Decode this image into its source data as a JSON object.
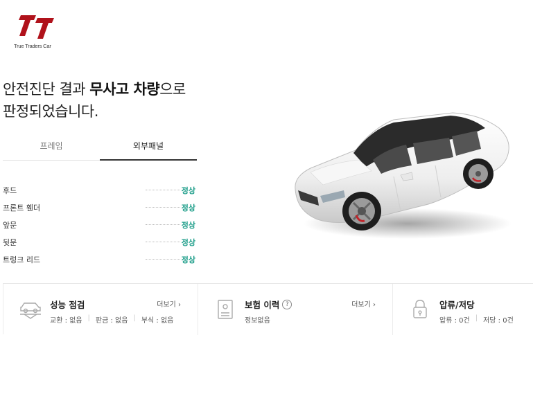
{
  "logo": {
    "subtitle": "True Traders Car"
  },
  "headline": {
    "line1_pre": "안전진단 결과 ",
    "line1_bold": "무사고 차량",
    "line1_post": "으로",
    "line2": "판정되었습니다."
  },
  "tabs": [
    {
      "label": "프레임"
    },
    {
      "label": "외부패널"
    }
  ],
  "parts": [
    {
      "name": "후드",
      "status": "정상"
    },
    {
      "name": "프론트 휀더",
      "status": "정상"
    },
    {
      "name": "앞문",
      "status": "정상"
    },
    {
      "name": "뒷문",
      "status": "정상"
    },
    {
      "name": "트렁크 리드",
      "status": "정상"
    }
  ],
  "cards": {
    "performance": {
      "title": "성능 점검",
      "more": "더보기 ›",
      "items": [
        "교환 : 없음",
        "판금 : 없음",
        "부식 : 없음"
      ]
    },
    "insurance": {
      "title": "보험 이력",
      "help": "?",
      "more": "더보기 ›",
      "sub": "정보없음"
    },
    "seizure": {
      "title": "압류/저당",
      "items": [
        "압류 : 0건",
        "저당 : 0건"
      ]
    }
  },
  "colors": {
    "brand": "#b0121b",
    "status_ok": "#1e9e8a"
  }
}
